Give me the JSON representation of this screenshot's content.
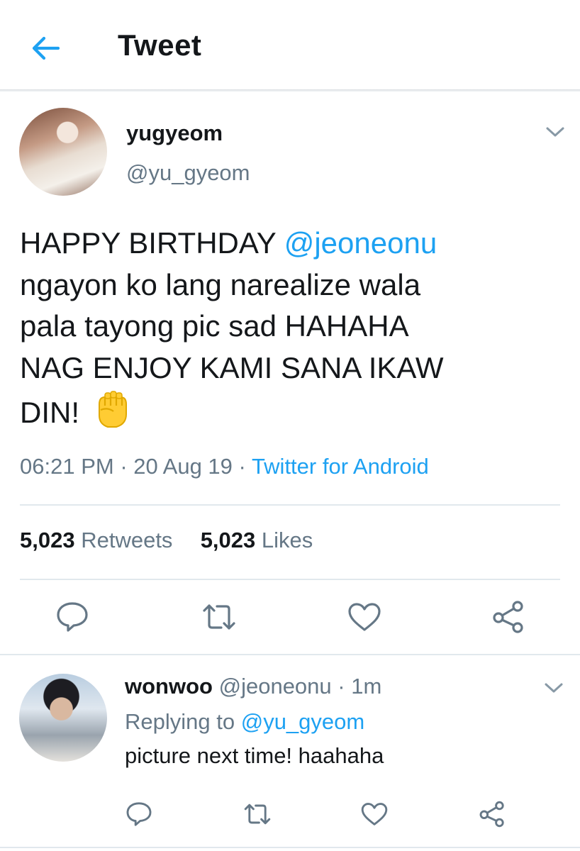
{
  "header": {
    "title": "Tweet"
  },
  "tweet": {
    "author": {
      "name": "yugyeom",
      "handle": "@yu_gyeom"
    },
    "text_lines": [
      {
        "pre": "HAPPY BIRTHDAY ",
        "mention": "@jeoneonu"
      },
      {
        "pre": "ngayon ko lang narealize wala"
      },
      {
        "pre": "pala tayong pic sad HAHAHA"
      },
      {
        "pre": "NAG ENJOY KAMI SANA IKAW"
      },
      {
        "pre": "DIN! "
      }
    ],
    "emoji": "raised-fist-icon",
    "time": "06:21 PM",
    "date": "20 Aug 19",
    "separator": "·",
    "source": "Twitter for Android",
    "retweets_count": "5,023",
    "retweets_label": "Retweets",
    "likes_count": "5,023",
    "likes_label": "Likes"
  },
  "reply": {
    "author": {
      "name": "wonwoo",
      "handle": "@jeoneonu"
    },
    "separator": "·",
    "time": "1m",
    "replying_prefix": "Replying to",
    "replying_to": "@yu_gyeom",
    "text": "picture next time! haahaha"
  },
  "colors": {
    "accent": "#1da1f2",
    "muted": "#657786",
    "divider": "#e1e8ed",
    "text": "#14171a"
  },
  "icons": [
    "back-arrow-icon",
    "chevron-down-icon",
    "reply-icon",
    "retweet-icon",
    "like-icon",
    "share-icon",
    "raised-fist-icon"
  ]
}
